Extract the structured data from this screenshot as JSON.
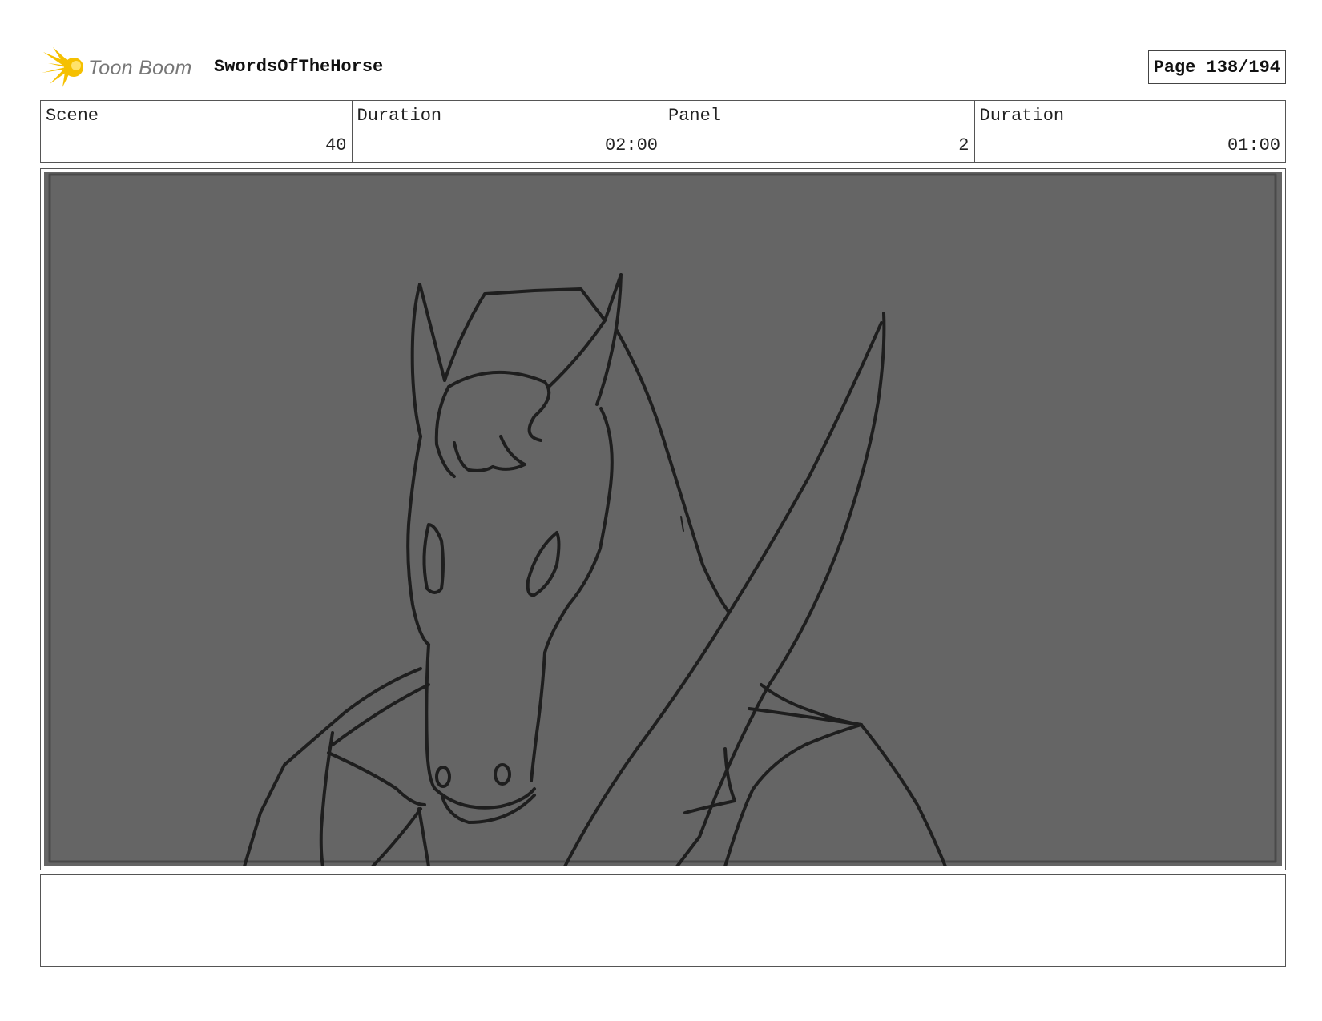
{
  "header": {
    "logo_text": "Toon Boom",
    "project_title": "SwordsOfTheHorse",
    "page_label": "Page 138/194"
  },
  "info": [
    {
      "label": "Scene",
      "value": "40"
    },
    {
      "label": "Duration",
      "value": "02:00"
    },
    {
      "label": "Panel",
      "value": "2"
    },
    {
      "label": "Duration",
      "value": "01:00"
    }
  ],
  "panel": {
    "background_color": "#656565",
    "line_color": "#1e1e1e"
  },
  "notes": {
    "text": ""
  }
}
